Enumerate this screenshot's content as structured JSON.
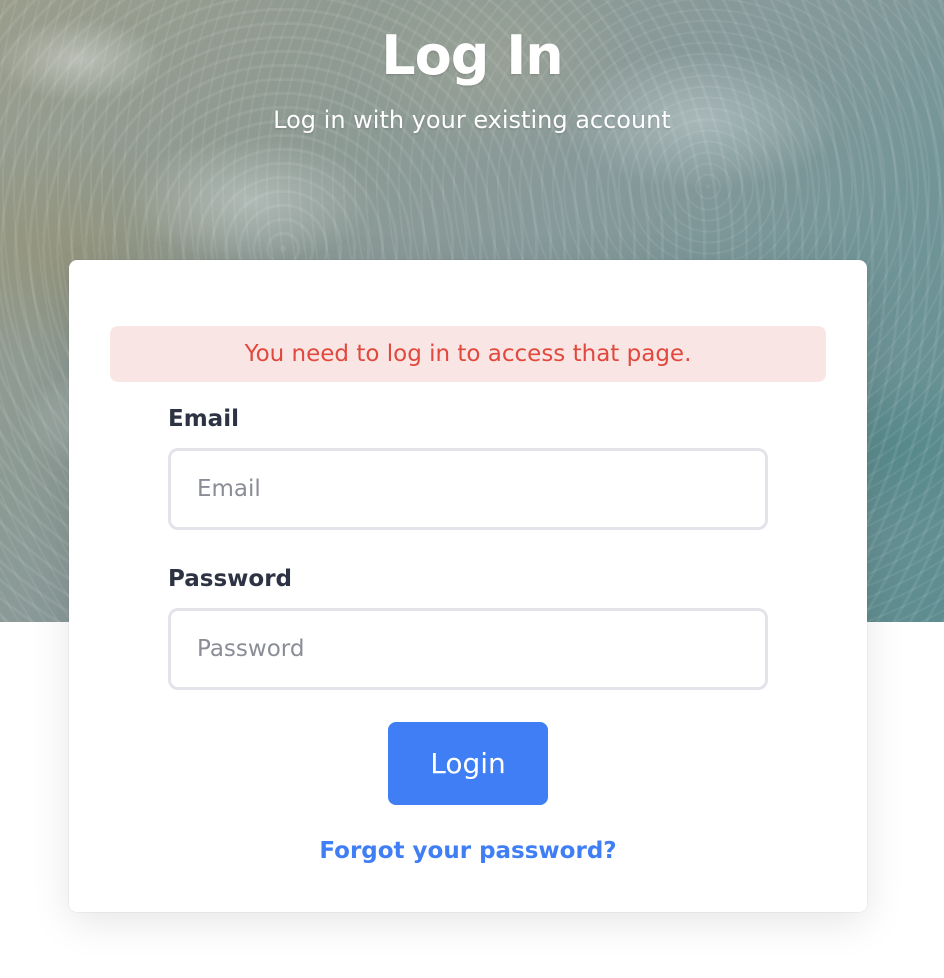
{
  "header": {
    "title": "Log In",
    "subtitle": "Log in with your existing account"
  },
  "alert": {
    "message": "You need to log in to access that page."
  },
  "form": {
    "email_label": "Email",
    "email_placeholder": "Email",
    "email_value": "",
    "password_label": "Password",
    "password_placeholder": "Password",
    "password_value": "",
    "submit_label": "Login",
    "forgot_link": "Forgot your password?"
  },
  "colors": {
    "accent": "#3f7ef4",
    "alert_background": "#f9e6e4",
    "alert_text": "#e2483d",
    "label_text": "#2d3342"
  }
}
